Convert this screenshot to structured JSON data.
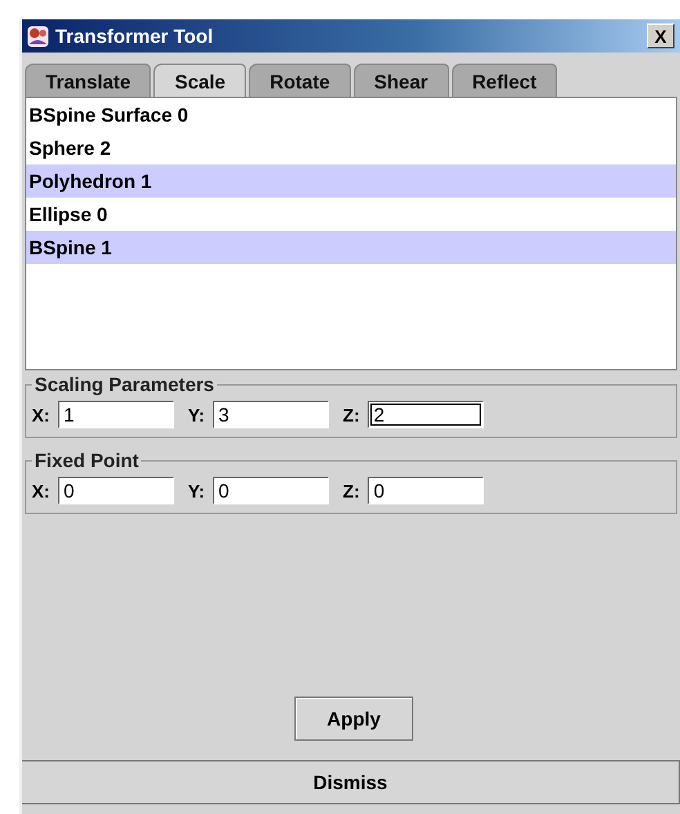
{
  "window": {
    "title": "Transformer Tool",
    "close": "X"
  },
  "tabs": [
    {
      "label": "Translate",
      "selected": false
    },
    {
      "label": "Scale",
      "selected": true
    },
    {
      "label": "Rotate",
      "selected": false
    },
    {
      "label": "Shear",
      "selected": false
    },
    {
      "label": "Reflect",
      "selected": false
    }
  ],
  "objects": [
    {
      "label": "BSpine Surface 0",
      "selected": false
    },
    {
      "label": "Sphere 2",
      "selected": false
    },
    {
      "label": "Polyhedron 1",
      "selected": true
    },
    {
      "label": "Ellipse 0",
      "selected": false
    },
    {
      "label": "BSpine 1",
      "selected": true
    }
  ],
  "groups": [
    {
      "title": "Scaling Parameters",
      "fields": [
        {
          "label": "X:",
          "value": "1",
          "focused": false
        },
        {
          "label": "Y:",
          "value": "3",
          "focused": false
        },
        {
          "label": "Z:",
          "value": "2",
          "focused": true
        }
      ]
    },
    {
      "title": "Fixed Point",
      "fields": [
        {
          "label": "X:",
          "value": "0",
          "focused": false
        },
        {
          "label": "Y:",
          "value": "0",
          "focused": false
        },
        {
          "label": "Z:",
          "value": "0",
          "focused": false
        }
      ]
    }
  ],
  "apply_button": "Apply",
  "dismiss_button": "Dismiss"
}
